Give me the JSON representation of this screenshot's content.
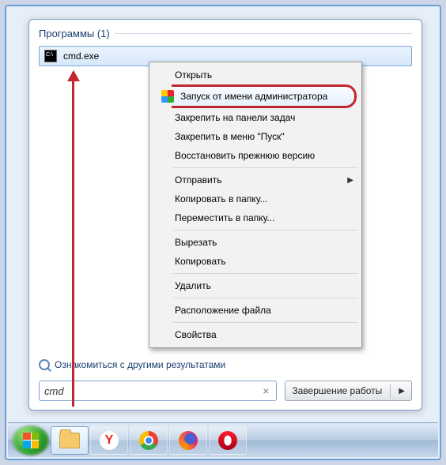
{
  "section_title": "Программы (1)",
  "result": {
    "filename": "cmd.exe"
  },
  "context_menu": {
    "open": "Открыть",
    "run_as_admin": "Запуск от имени администратора",
    "pin_taskbar": "Закрепить на панели задач",
    "pin_start": "Закрепить в меню \"Пуск\"",
    "restore_prev": "Восстановить прежнюю версию",
    "send_to": "Отправить",
    "copy_to": "Копировать в папку...",
    "move_to": "Переместить в папку...",
    "cut": "Вырезать",
    "copy": "Копировать",
    "delete": "Удалить",
    "open_location": "Расположение файла",
    "properties": "Свойства"
  },
  "more_results": "Ознакомиться с другими результатами",
  "search": {
    "value": "cmd"
  },
  "shutdown_label": "Завершение работы",
  "taskbar": {
    "yandex_letter": "Y"
  }
}
